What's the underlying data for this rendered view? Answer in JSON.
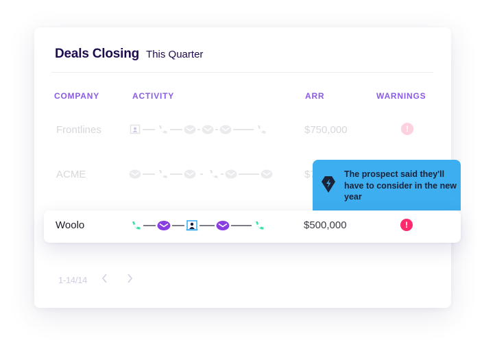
{
  "header": {
    "title": "Deals Closing",
    "subtitle": "This Quarter"
  },
  "columns": [
    "COMPANY",
    "ACTIVITY",
    "ARR",
    "WARNINGS"
  ],
  "rows": [
    {
      "company": "Frontlines",
      "arr": "$750,000",
      "warning": "!",
      "state": "faded",
      "activity": [
        "meeting",
        "call",
        "email",
        "email",
        "email",
        "call"
      ]
    },
    {
      "company": "ACME",
      "arr": "$750,000",
      "warning": "",
      "state": "faded",
      "activity": [
        "email",
        "call",
        "email",
        "call",
        "email",
        "email"
      ]
    },
    {
      "company": "Woolo",
      "arr": "$500,000",
      "warning": "!",
      "state": "highlighted",
      "activity": [
        "call",
        "email",
        "meeting",
        "email",
        "call"
      ]
    }
  ],
  "tooltip": {
    "text": "The prospect said they'll have to consider in the new year",
    "icon": "brand-diamond-bolt-icon"
  },
  "pagination": {
    "range": "1-14/14",
    "prev_icon": "chevron-left-icon",
    "next_icon": "chevron-right-icon"
  },
  "colors": {
    "title": "#1e0a4f",
    "column_header": "#8a5ce6",
    "call": "#3ee0b0",
    "email": "#8a3ee0",
    "meeting": "#3daef0",
    "warning": "#ff2a6d",
    "warning_faded": "#ffd1df",
    "tooltip_bg": "#3daef0"
  }
}
